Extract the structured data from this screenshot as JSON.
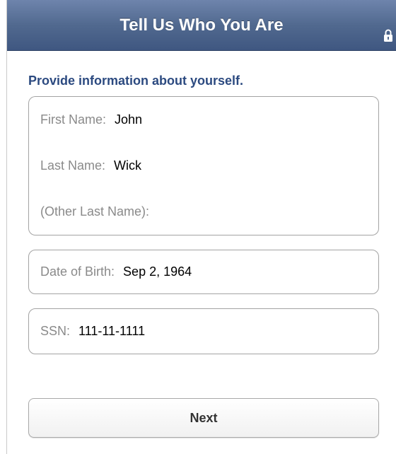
{
  "header": {
    "title": "Tell Us Who You Are",
    "icon": "lock-icon"
  },
  "form": {
    "subtitle": "Provide information about yourself.",
    "fields": [
      {
        "label": "First Name:",
        "value": "John"
      },
      {
        "label": "Last Name:",
        "value": "Wick"
      },
      {
        "label": "(Other Last Name):",
        "value": ""
      },
      {
        "label": "Date of Birth:",
        "value": "Sep 2, 1964"
      },
      {
        "label": "SSN:",
        "value": "111-11-1111"
      }
    ],
    "next_label": "Next"
  },
  "colors": {
    "nav_bar": "#51698f",
    "subtitle": "#2c4a80",
    "label": "#8a8a8a"
  }
}
